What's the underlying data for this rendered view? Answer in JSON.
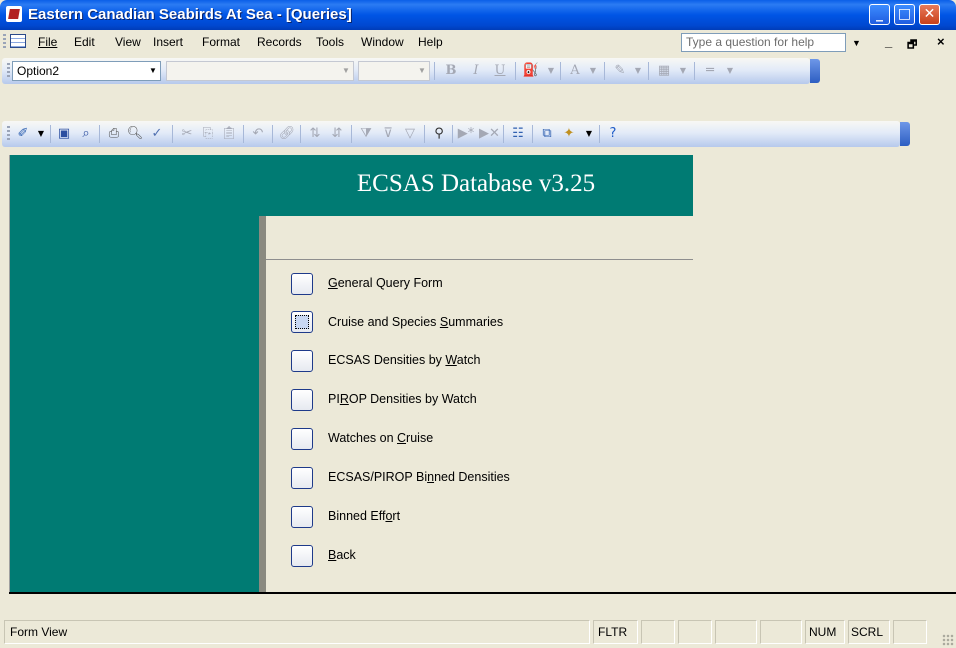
{
  "window": {
    "title": "Eastern Canadian Seabirds At Sea - [Queries]",
    "minimize_glyph": "_",
    "maximize_glyph": "□",
    "close_glyph": "✕"
  },
  "menu": {
    "items": [
      "File",
      "Edit",
      "View",
      "Insert",
      "Format",
      "Records",
      "Tools",
      "Window",
      "Help"
    ],
    "help_placeholder": "Type a question for help",
    "mdi_min": "_",
    "mdi_restore": "🗗",
    "mdi_close": "×"
  },
  "format_toolbar": {
    "object_combo": "Option2",
    "font_combo": "",
    "size_combo": "",
    "bold": "B",
    "italic": "I",
    "underline": "U",
    "font_color": "A"
  },
  "form": {
    "header_title": "ECSAS Database v3.25",
    "buttons": [
      {
        "pre": "",
        "u": "G",
        "post": "eneral Query Form"
      },
      {
        "pre": "Cruise and Species ",
        "u": "S",
        "post": "ummaries"
      },
      {
        "pre": "ECSAS Densities by ",
        "u": "W",
        "post": "atch"
      },
      {
        "pre": "PI",
        "u": "R",
        "post": "OP Densities by Watch"
      },
      {
        "pre": "Watches on ",
        "u": "C",
        "post": "ruise"
      },
      {
        "pre": "ECSAS/PIROP Bi",
        "u": "n",
        "post": "ned Densities"
      },
      {
        "pre": "Binned Eff",
        "u": "o",
        "post": "rt"
      },
      {
        "pre": "",
        "u": "B",
        "post": "ack"
      }
    ]
  },
  "status": {
    "left": "Form View",
    "fltr": "FLTR",
    "num": "NUM",
    "scrl": "SCRL"
  },
  "colors": {
    "teal": "#007B73",
    "title_blue": "#0055E5",
    "face": "#ECE9D8"
  }
}
